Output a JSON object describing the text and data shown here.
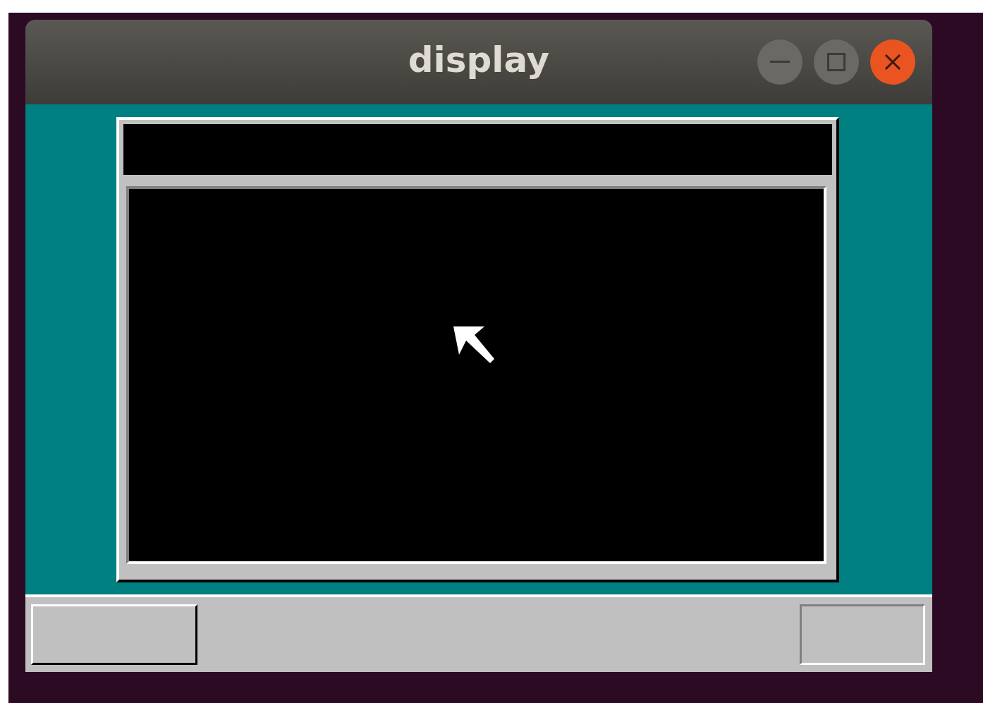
{
  "window": {
    "title": "display"
  }
}
